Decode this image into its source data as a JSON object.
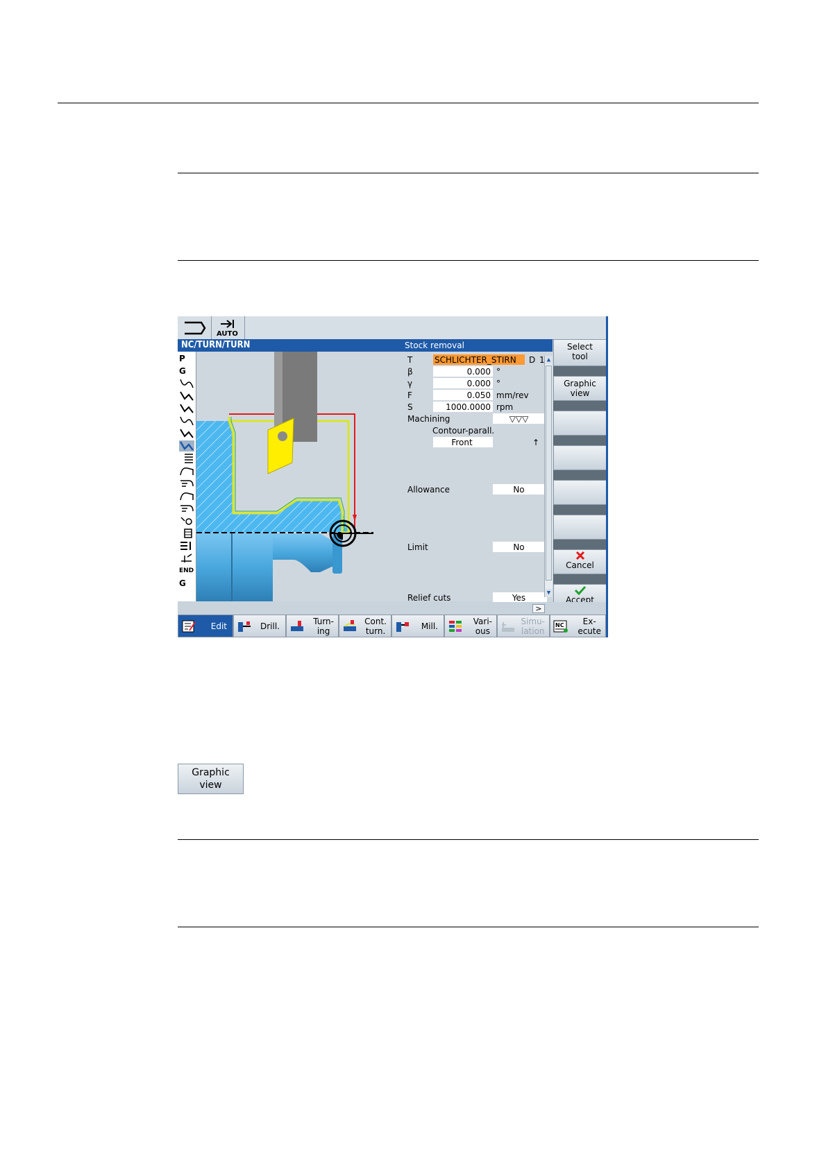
{
  "screen": {
    "topstrip": {
      "mode_label": "AUTO"
    },
    "titlebar": {
      "path": "NC/TURN/TURN",
      "cycle": "Stock removal"
    },
    "left_column": {
      "top_items": [
        "P",
        "G"
      ],
      "bottom_items": [
        "END",
        "G"
      ]
    },
    "params": {
      "T": {
        "label": "T",
        "value": "SCHLICHTER_STIRN",
        "d_label": "D",
        "d_value": "1"
      },
      "beta": {
        "label": "β",
        "value": "0.000",
        "unit": "°"
      },
      "gamma": {
        "label": "γ",
        "value": "0.000",
        "unit": "°"
      },
      "F": {
        "label": "F",
        "value": "0.050",
        "unit": "mm/rev"
      },
      "S": {
        "label": "S",
        "value": "1000.0000",
        "unit": "rpm"
      },
      "machining": {
        "label": "Machining",
        "value": "▽▽▽",
        "mode": "Contour-parall.",
        "direction": "Front",
        "arrow": "↑"
      },
      "allowance": {
        "label": "Allowance",
        "value": "No"
      },
      "limit": {
        "label": "Limit",
        "value": "No"
      },
      "relief": {
        "label": "Relief cuts",
        "value": "Yes"
      }
    },
    "vertical_softkeys": {
      "select_tool": "Select\ntool",
      "graphic_view": "Graphic\nview",
      "cancel": "Cancel",
      "accept": "Accept"
    },
    "horizontal_softkeys": {
      "edit": "Edit",
      "drill": "Drill.",
      "turning": "Turn-\ning",
      "cont_turn": "Cont.\nturn.",
      "mill": "Mill.",
      "various": "Vari-\nous",
      "simulation": "Simu-\nlation",
      "execute": "Ex-\necute"
    },
    "scroll_right": ">",
    "colors": {
      "accent": "#1e5aa8",
      "highlight": "#ff9933",
      "tool": "#ffee00",
      "workpiece": "#4db8f0"
    }
  },
  "standalone_button": "Graphic\nview"
}
